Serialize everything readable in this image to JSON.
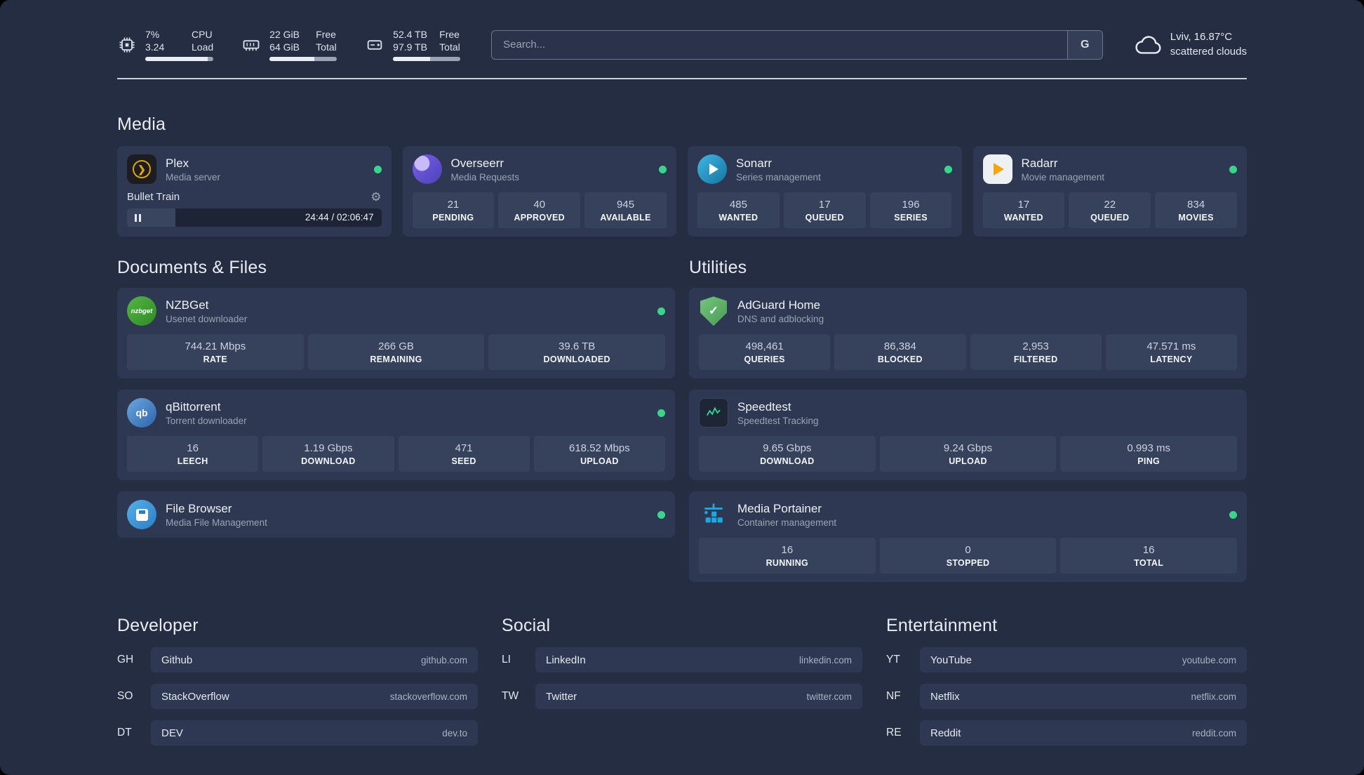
{
  "topbar": {
    "resources": [
      {
        "icon": "cpu-icon",
        "value_top": "7%",
        "value_bottom": "3.24",
        "label_top": "CPU",
        "label_bottom": "Load"
      },
      {
        "icon": "memory-icon",
        "value_top": "22 GiB",
        "value_bottom": "64 GiB",
        "label_top": "Free",
        "label_bottom": "Total"
      },
      {
        "icon": "disk-icon",
        "value_top": "52.4 TB",
        "value_bottom": "97.9 TB",
        "label_top": "Free",
        "label_bottom": "Total"
      }
    ],
    "search": {
      "placeholder": "Search...",
      "button_label": "G"
    },
    "weather": {
      "icon": "cloud-icon",
      "location": "Lviv, 16.87°C",
      "condition": "scattered clouds"
    }
  },
  "sections": {
    "media": {
      "title": "Media",
      "services": [
        {
          "name": "Plex",
          "desc": "Media server",
          "icon": "plex-icon",
          "status": "online",
          "player": {
            "track": "Bullet Train",
            "time": "24:44 / 02:06:47",
            "progress_percent": 19
          }
        },
        {
          "name": "Overseerr",
          "desc": "Media Requests",
          "icon": "overseerr-icon",
          "status": "online",
          "stats": [
            {
              "value": "21",
              "label": "PENDING"
            },
            {
              "value": "40",
              "label": "APPROVED"
            },
            {
              "value": "945",
              "label": "AVAILABLE"
            }
          ]
        },
        {
          "name": "Sonarr",
          "desc": "Series management",
          "icon": "sonarr-icon",
          "status": "online",
          "stats": [
            {
              "value": "485",
              "label": "WANTED"
            },
            {
              "value": "17",
              "label": "QUEUED"
            },
            {
              "value": "196",
              "label": "SERIES"
            }
          ]
        },
        {
          "name": "Radarr",
          "desc": "Movie management",
          "icon": "radarr-icon",
          "status": "online",
          "stats": [
            {
              "value": "17",
              "label": "WANTED"
            },
            {
              "value": "22",
              "label": "QUEUED"
            },
            {
              "value": "834",
              "label": "MOVIES"
            }
          ]
        }
      ]
    },
    "documents": {
      "title": "Documents & Files",
      "services": [
        {
          "name": "NZBGet",
          "desc": "Usenet downloader",
          "icon": "nzbget-icon",
          "status": "online",
          "stats": [
            {
              "value": "744.21 Mbps",
              "label": "RATE"
            },
            {
              "value": "266 GB",
              "label": "REMAINING"
            },
            {
              "value": "39.6 TB",
              "label": "DOWNLOADED"
            }
          ]
        },
        {
          "name": "qBittorrent",
          "desc": "Torrent downloader",
          "icon": "qbittorrent-icon",
          "status": "online",
          "stats": [
            {
              "value": "16",
              "label": "LEECH"
            },
            {
              "value": "1.19 Gbps",
              "label": "DOWNLOAD"
            },
            {
              "value": "471",
              "label": "SEED"
            },
            {
              "value": "618.52 Mbps",
              "label": "UPLOAD"
            }
          ]
        },
        {
          "name": "File Browser",
          "desc": "Media File Management",
          "icon": "filebrowser-icon",
          "status": "online",
          "stats": []
        }
      ]
    },
    "utilities": {
      "title": "Utilities",
      "services": [
        {
          "name": "AdGuard Home",
          "desc": "DNS and adblocking",
          "icon": "adguard-icon",
          "stats": [
            {
              "value": "498,461",
              "label": "QUERIES"
            },
            {
              "value": "86,384",
              "label": "BLOCKED"
            },
            {
              "value": "2,953",
              "label": "FILTERED"
            },
            {
              "value": "47.571 ms",
              "label": "LATENCY"
            }
          ]
        },
        {
          "name": "Speedtest",
          "desc": "Speedtest Tracking",
          "icon": "speedtest-icon",
          "stats": [
            {
              "value": "9.65 Gbps",
              "label": "DOWNLOAD"
            },
            {
              "value": "9.24 Gbps",
              "label": "UPLOAD"
            },
            {
              "value": "0.993 ms",
              "label": "PING"
            }
          ]
        },
        {
          "name": "Media Portainer",
          "desc": "Container management",
          "icon": "portainer-icon",
          "status": "online",
          "stats": [
            {
              "value": "16",
              "label": "RUNNING"
            },
            {
              "value": "0",
              "label": "STOPPED"
            },
            {
              "value": "16",
              "label": "TOTAL"
            }
          ]
        }
      ]
    }
  },
  "bookmarks": [
    {
      "title": "Developer",
      "links": [
        {
          "abbr": "GH",
          "name": "Github",
          "url": "github.com"
        },
        {
          "abbr": "SO",
          "name": "StackOverflow",
          "url": "stackoverflow.com"
        },
        {
          "abbr": "DT",
          "name": "DEV",
          "url": "dev.to"
        }
      ]
    },
    {
      "title": "Social",
      "links": [
        {
          "abbr": "LI",
          "name": "LinkedIn",
          "url": "linkedin.com"
        },
        {
          "abbr": "TW",
          "name": "Twitter",
          "url": "twitter.com"
        }
      ]
    },
    {
      "title": "Entertainment",
      "links": [
        {
          "abbr": "YT",
          "name": "YouTube",
          "url": "youtube.com"
        },
        {
          "abbr": "NF",
          "name": "Netflix",
          "url": "netflix.com"
        },
        {
          "abbr": "RE",
          "name": "Reddit",
          "url": "reddit.com"
        }
      ]
    }
  ]
}
